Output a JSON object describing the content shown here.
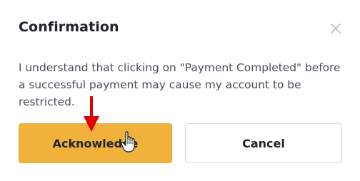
{
  "dialog": {
    "title": "Confirmation",
    "message": "I understand that clicking on \"Payment Completed\" before a successful payment may cause my account to be restricted.",
    "acknowledge_label": "Acknowledge",
    "cancel_label": "Cancel",
    "close_icon": "close-icon"
  },
  "colors": {
    "primary": "#f0b23a",
    "annotation_arrow": "#e00000",
    "title_text": "#1e2329",
    "body_text": "#474d57"
  }
}
